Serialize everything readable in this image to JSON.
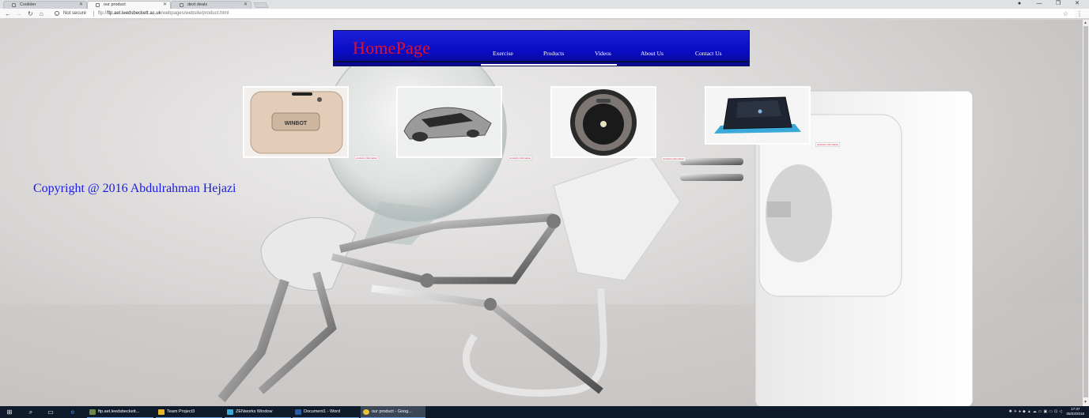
{
  "browser": {
    "tabs": [
      {
        "title": "Coolider",
        "active": false
      },
      {
        "title": "our product",
        "active": true
      },
      {
        "title": "dext deals",
        "active": false
      }
    ],
    "security_label": "Not secure",
    "url_prefix": "ftp://",
    "url_host": "ftp.aet.leedsbeckett.ac.uk",
    "url_path": "/webpages/website/product.html"
  },
  "site": {
    "title": "HomePage",
    "nav": [
      "Exercise",
      "Products",
      "Videos",
      "About Us",
      "Contact Us"
    ],
    "copyright": "Copyright @ 2016 Abdulrahman Hejazi",
    "products": [
      {
        "name": "WINBOT",
        "label": "products information"
      },
      {
        "name": "robotic lawn mower",
        "label": "products information"
      },
      {
        "name": "robot vacuum",
        "label": "products information"
      },
      {
        "name": "floor cleaning robot",
        "label": "products information"
      }
    ],
    "colors": {
      "nav_bg": "#0a0cc4",
      "title": "#e0102a",
      "copyright": "#1a1ae6"
    }
  },
  "taskbar": {
    "apps": [
      "ftp.aet.leedsbeckett...",
      "Team Project3",
      "ZENworks Window",
      "Document1 - Word",
      "our product - Goog..."
    ],
    "time": "17:37",
    "date": "05/03/2018"
  }
}
